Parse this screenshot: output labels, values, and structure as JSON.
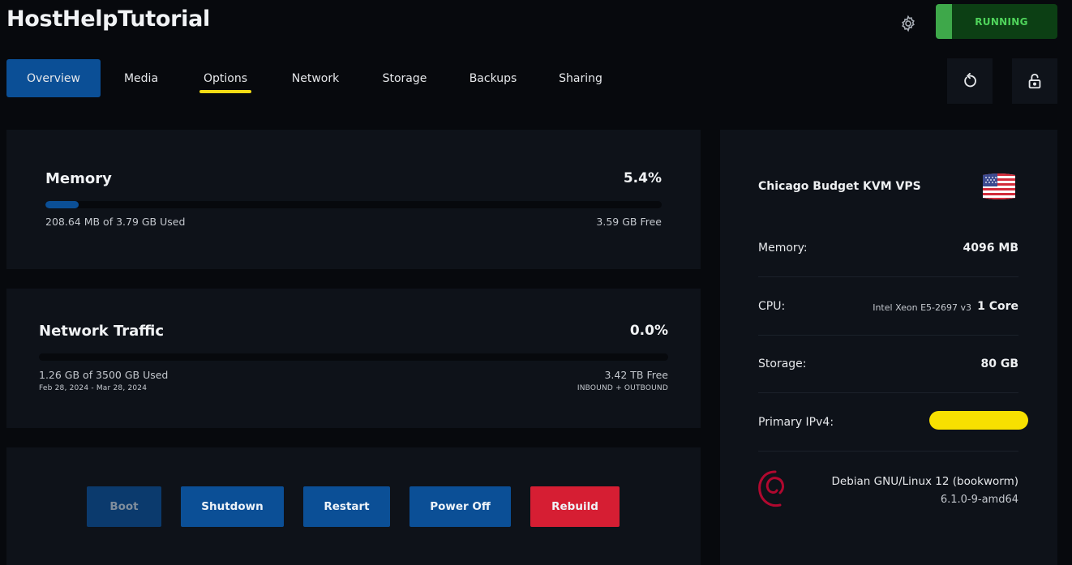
{
  "header": {
    "title": "HostHelpTutorial",
    "status_label": "RUNNING",
    "settings_icon": "gear-icon"
  },
  "tabs": [
    {
      "label": "Overview",
      "active": true
    },
    {
      "label": "Media"
    },
    {
      "label": "Options",
      "underlined": true
    },
    {
      "label": "Network"
    },
    {
      "label": "Storage"
    },
    {
      "label": "Backups"
    },
    {
      "label": "Sharing"
    }
  ],
  "toolbar_icons": [
    "reinstall-icon",
    "unlock-icon"
  ],
  "memory": {
    "title": "Memory",
    "percent_label": "5.4%",
    "used_fraction": 0.054,
    "used_text": "208.64 MB of 3.79 GB Used",
    "free_text": "3.59 GB Free"
  },
  "network": {
    "title": "Network Traffic",
    "percent_label": "0.0%",
    "used_fraction": 0.0,
    "used_text": "1.26 GB of 3500 GB Used",
    "date_range": "Feb 28, 2024 - Mar 28, 2024",
    "free_text": "3.42 TB Free",
    "direction": "INBOUND + OUTBOUND"
  },
  "actions": {
    "boot": "Boot",
    "shutdown": "Shutdown",
    "restart": "Restart",
    "power_off": "Power Off",
    "rebuild": "Rebuild"
  },
  "server": {
    "name": "Chicago Budget KVM VPS",
    "flag_icon": "us-flag-icon",
    "memory_label": "Memory:",
    "memory_value": "4096 MB",
    "cpu_label": "CPU:",
    "cpu_model": "Intel Xeon E5-2697 v3",
    "cpu_cores": "1 Core",
    "storage_label": "Storage:",
    "storage_value": "80 GB",
    "ipv4_label": "Primary IPv4:",
    "os_name": "Debian GNU/Linux 12 (bookworm)",
    "kernel": "6.1.0-9-amd64",
    "os_icon": "debian-logo-icon"
  },
  "colors": {
    "accent_blue": "#0b4f96",
    "running_green": "#4fd45b",
    "danger_red": "#d61e33",
    "highlight_yellow": "#f3dc14"
  }
}
